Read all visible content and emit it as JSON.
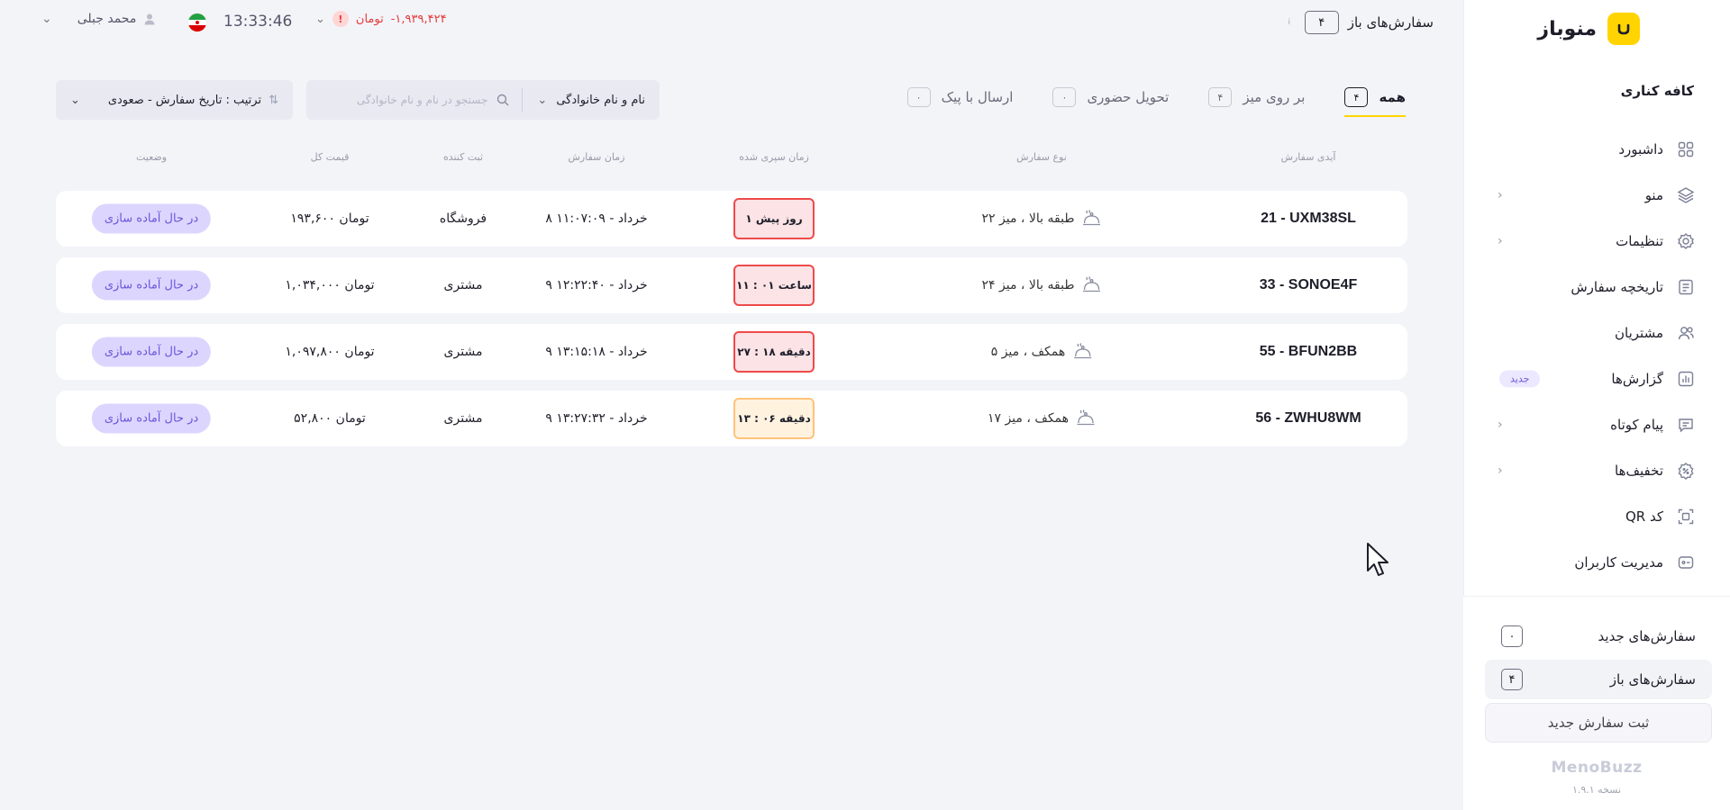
{
  "brand": {
    "name": "منوباز",
    "accent": "#ffd400"
  },
  "sidebar": {
    "cafe_name": "کافه کناری",
    "items": [
      {
        "label": "داشبورد",
        "icon": "dashboard-icon",
        "chevron": false
      },
      {
        "label": "منو",
        "icon": "layers-icon",
        "chevron": true
      },
      {
        "label": "تنظیمات",
        "icon": "gear-icon",
        "chevron": true
      },
      {
        "label": "تاریخچه سفارش",
        "icon": "history-icon",
        "chevron": false
      },
      {
        "label": "مشتریان",
        "icon": "users-icon",
        "chevron": false
      },
      {
        "label": "گزارش‌ها",
        "icon": "chart-icon",
        "chevron": false,
        "badge": "جدید"
      },
      {
        "label": "پیام کوتاه",
        "icon": "message-icon",
        "chevron": true
      },
      {
        "label": "تخفیف‌ها",
        "icon": "discount-icon",
        "chevron": true
      },
      {
        "label": "کد QR",
        "icon": "qr-icon",
        "chevron": false
      },
      {
        "label": "مدیریت کاربران",
        "icon": "user-manage-icon",
        "chevron": false
      }
    ],
    "new_orders": {
      "label": "سفارش‌های جدید",
      "count": "۰"
    },
    "open_orders": {
      "label": "سفارش‌های باز",
      "count": "۴"
    },
    "new_order_button": "ثبت سفارش جدید",
    "footer_brand": "MenoBuzz",
    "version": "نسخه ۱.۹.۱"
  },
  "topbar": {
    "open_orders_label": "سفارش‌های باز",
    "open_orders_count": "۴",
    "balance": "-۱,۹۳۹,۴۲۴",
    "balance_unit": "تومان",
    "time": "13:33:46",
    "user_name": "محمد جبلی"
  },
  "tabs": [
    {
      "label": "همه",
      "count": "۴",
      "active": true
    },
    {
      "label": "بر روی میز",
      "count": "۴",
      "active": false
    },
    {
      "label": "تحویل حضوری",
      "count": "۰",
      "active": false
    },
    {
      "label": "ارسال با پیک",
      "count": "۰",
      "active": false
    }
  ],
  "filter": {
    "select_value": "نام و نام خانوادگی",
    "search_placeholder": "جستجو در  نام و نام خانوادگی"
  },
  "sort": {
    "label": "ترتیب : تاریخ سفارش - صعودی"
  },
  "columns": {
    "order_id": "آیدی سفارش",
    "order_type": "نوع سفارش",
    "elapsed": "زمان سپری شده",
    "order_time": "زمان سفارش",
    "registrar": "ثبت کننده",
    "total": "قیمت کل",
    "status": "وضعیت"
  },
  "orders": [
    {
      "id": "21 - UXM38SL",
      "type": "طبقه بالا ، میز ۲۲",
      "elapsed": "۱ روز پیش",
      "elapsed_level": "red",
      "time": "۸ خرداد - ۱۱:۰۷:۰۹",
      "registrar": "فروشگاه",
      "total": "۱۹۳,۶۰۰ تومان",
      "status": "در حال آماده سازی"
    },
    {
      "id": "33 - SONOE4F",
      "type": "طبقه بالا ، میز ۲۴",
      "elapsed": "۱۱ : ۰۱ ساعت",
      "elapsed_level": "red",
      "time": "۹ خرداد - ۱۲:۲۲:۴۰",
      "registrar": "مشتری",
      "total": "۱,۰۳۴,۰۰۰ تومان",
      "status": "در حال آماده سازی"
    },
    {
      "id": "55 - BFUN2BB",
      "type": "همکف ، میز ۵",
      "elapsed": "۲۷ : ۱۸ دقیقه",
      "elapsed_level": "red",
      "time": "۹ خرداد - ۱۳:۱۵:۱۸",
      "registrar": "مشتری",
      "total": "۱,۰۹۷,۸۰۰ تومان",
      "status": "در حال آماده سازی"
    },
    {
      "id": "56 - ZWHU8WM",
      "type": "همکف ، میز ۱۷",
      "elapsed": "۱۳ : ۰۶ دقیقه",
      "elapsed_level": "orange",
      "time": "۹ خرداد - ۱۳:۲۷:۳۲",
      "registrar": "مشتری",
      "total": "۵۲,۸۰۰ تومان",
      "status": "در حال آماده سازی"
    }
  ]
}
